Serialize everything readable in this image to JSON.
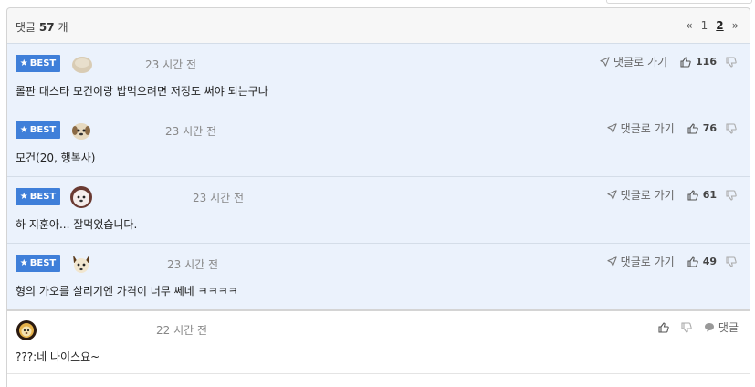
{
  "header": {
    "count_prefix": "댓글",
    "count_value": "57",
    "count_suffix": "개"
  },
  "pager": {
    "prev": "«",
    "pages": [
      "1",
      "2"
    ],
    "current": "2",
    "next": "»"
  },
  "labels": {
    "best": "BEST",
    "reply_link": "댓글로 가기",
    "reply": "댓글"
  },
  "colors": {
    "best_badge": "#3f7fd9",
    "best_row": "#ebf2fc"
  },
  "comments": [
    {
      "best": true,
      "avatar": "round-beige-avatar",
      "time": "23 시간 전",
      "likes": "116",
      "text": "롤판 대스타 모건이랑 밥먹으려면 저정도 써야 되는구나"
    },
    {
      "best": true,
      "avatar": "puppy-avatar",
      "time": "23 시간 전",
      "likes": "76",
      "text": "모건(20, 행복사)"
    },
    {
      "best": true,
      "avatar": "fluffy-dog-avatar",
      "time": "23 시간 전",
      "likes": "61",
      "text": "하 지훈아... 잘먹었습니다."
    },
    {
      "best": true,
      "avatar": "fox-dog-avatar",
      "time": "23 시간 전",
      "likes": "49",
      "text": "형의 가오를 살리기엔 가격이 너무 쎄네 ㅋㅋㅋㅋ"
    },
    {
      "best": false,
      "avatar": "lion-avatar",
      "time": "22 시간 전",
      "text": "???:네 나이스요~"
    }
  ]
}
